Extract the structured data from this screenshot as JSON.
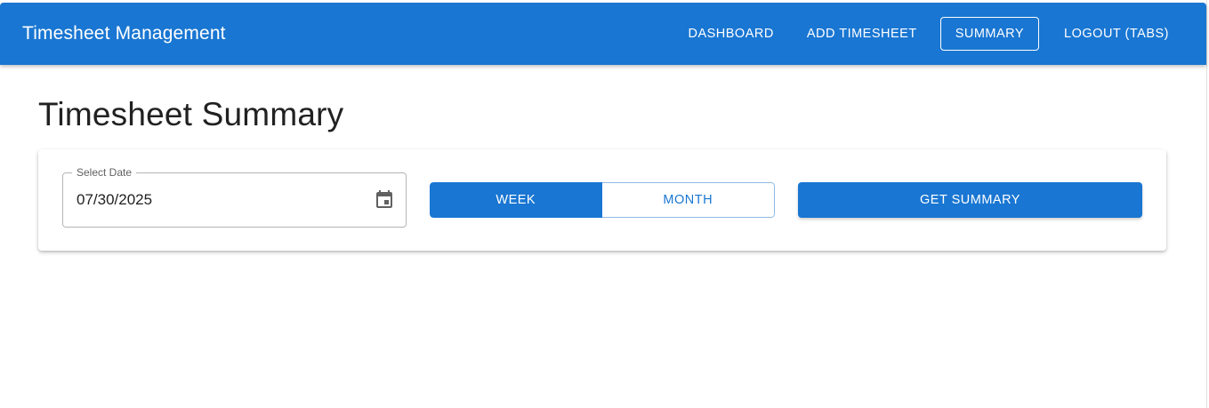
{
  "header": {
    "title": "Timesheet Management",
    "nav": [
      {
        "label": "DASHBOARD"
      },
      {
        "label": "ADD TIMESHEET"
      },
      {
        "label": "SUMMARY",
        "active": true
      },
      {
        "label": "LOGOUT (TABS)"
      }
    ]
  },
  "page": {
    "title": "Timesheet Summary"
  },
  "filters": {
    "date_label": "Select Date",
    "date_value": "07/30/2025",
    "calendar_icon": "calendar-icon",
    "period_options": [
      {
        "label": "WEEK",
        "selected": true
      },
      {
        "label": "MONTH",
        "selected": false
      }
    ],
    "submit_label": "GET SUMMARY"
  },
  "colors": {
    "primary": "#1976d2",
    "text": "#212121",
    "background": "#ffffff"
  }
}
